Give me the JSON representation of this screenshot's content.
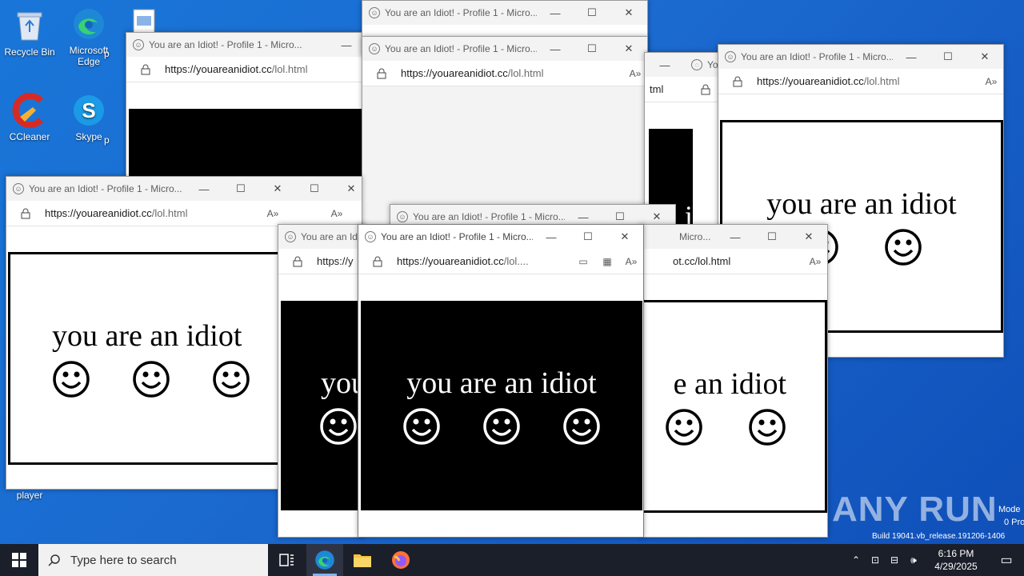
{
  "desktop": {
    "icons": [
      {
        "label": "Recycle Bin",
        "icon": "recycle-bin-icon"
      },
      {
        "label": "Microsoft Edge",
        "icon": "edge-icon"
      },
      {
        "label": "CCleaner",
        "icon": "ccleaner-icon"
      },
      {
        "label": "Skype",
        "icon": "skype-icon"
      },
      {
        "label": "player",
        "icon": "player-icon"
      },
      {
        "label": "p",
        "icon": "file-icon"
      }
    ],
    "build_lines": [
      "Mode",
      "0 Pro",
      "Build 19041.vb_release.191206-1406"
    ],
    "watermark": "ANY RUN"
  },
  "window": {
    "title": "You are an Idiot! - Profile 1 - Micro...",
    "title_short": "Yo",
    "url_domain": "https://youareanidiot.cc",
    "url_path": "/lol.html",
    "url_domain_short": "https://y",
    "url_trunc_path": "/lol....",
    "url_tail": "ot.cc/lol.html",
    "url_tail2": "tml",
    "page_text": "you are an idiot",
    "page_text_partial": "e an idiot",
    "page_text_you": "you",
    "page_text_ii": "i i",
    "title_micro": "Micro...",
    "min_label": "—",
    "max_label": "☐",
    "close_label": "✕"
  },
  "taskbar": {
    "search_placeholder": "Type here to search",
    "time": "6:16 PM",
    "date": "4/29/2025"
  },
  "colors": {
    "desktop": "#1a6fd6",
    "taskbar": "#1b1f2a",
    "accent": "#7cb7ff"
  }
}
